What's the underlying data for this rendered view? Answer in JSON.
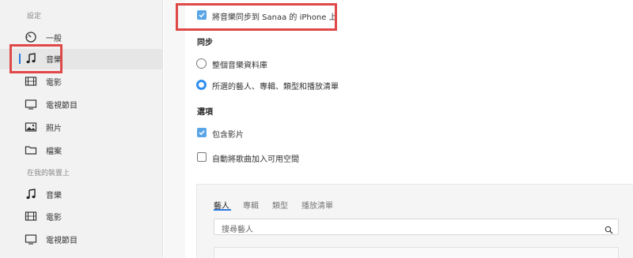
{
  "sidebar": {
    "section_settings": "設定",
    "section_on_device": "在我的裝置上",
    "settings_items": [
      {
        "label": "一般",
        "icon": "gear-icon"
      },
      {
        "label": "音樂",
        "icon": "music-note-icon"
      },
      {
        "label": "電影",
        "icon": "film-icon"
      },
      {
        "label": "電視節目",
        "icon": "tv-icon"
      },
      {
        "label": "照片",
        "icon": "photo-icon"
      },
      {
        "label": "檔案",
        "icon": "folder-icon"
      }
    ],
    "device_items": [
      {
        "label": "音樂",
        "icon": "music-note-icon"
      },
      {
        "label": "電影",
        "icon": "film-icon"
      },
      {
        "label": "電視節目",
        "icon": "tv-icon"
      }
    ],
    "active_index": 1
  },
  "main": {
    "sync_checkbox_label": "將音樂同步到 Sanaa 的 iPhone 上",
    "sync_checked": true,
    "sync_heading": "同步",
    "sync_options": [
      {
        "label": "整個音樂資料庫",
        "selected": false
      },
      {
        "label": "所選的藝人、專輯、類型和播放清單",
        "selected": true
      }
    ],
    "options_heading": "選項",
    "options": [
      {
        "label": "包含影片",
        "checked": true
      },
      {
        "label": "自動將歌曲加入可用空間",
        "checked": false
      }
    ],
    "tabs": [
      "藝人",
      "專輯",
      "類型",
      "播放清單"
    ],
    "active_tab": 0,
    "search_placeholder": "搜尋藝人"
  },
  "colors": {
    "accent": "#2a7ae2",
    "checkbox": "#5aa5e6",
    "highlight_outline": "#e04848"
  }
}
